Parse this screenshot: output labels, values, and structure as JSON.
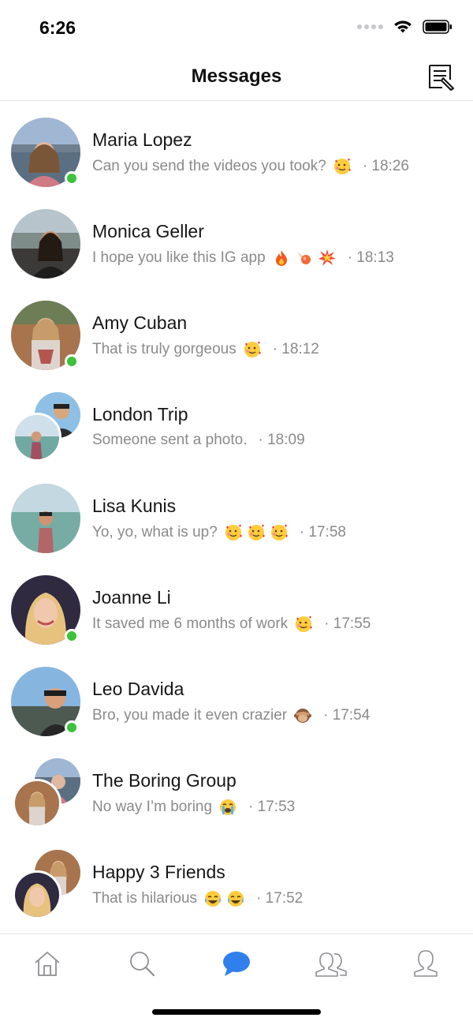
{
  "status_bar": {
    "time": "6:26"
  },
  "nav": {
    "title": "Messages"
  },
  "colors": {
    "online": "#3cc23b",
    "active_tab": "#2f80ed",
    "inactive_tab": "#8e8e93",
    "preview_text": "#8a8a8a"
  },
  "conversations": [
    {
      "name": "Maria Lopez",
      "message": "Can you send the videos you took?",
      "emojis": [
        "smiling-hearts"
      ],
      "time": "· 18:26",
      "online": true,
      "group": false
    },
    {
      "name": "Monica Geller",
      "message": "I hope you like this IG app",
      "emojis": [
        "fire",
        "comet",
        "collision"
      ],
      "time": "· 18:13",
      "online": false,
      "group": false
    },
    {
      "name": "Amy Cuban",
      "message": "That is truly gorgeous",
      "emojis": [
        "smiling-hearts"
      ],
      "time": "· 18:12",
      "online": true,
      "group": false
    },
    {
      "name": "London Trip",
      "message": "Someone sent a photo.",
      "emojis": [],
      "time": "· 18:09",
      "online": false,
      "group": true
    },
    {
      "name": "Lisa Kunis",
      "message": "Yo, yo, what is up?",
      "emojis": [
        "smiling-hearts",
        "smiling-hearts",
        "smiling-hearts"
      ],
      "time": "· 17:58",
      "online": false,
      "group": false
    },
    {
      "name": "Joanne Li",
      "message": "It saved me 6 months of work",
      "emojis": [
        "smiling-hearts"
      ],
      "time": "· 17:55",
      "online": true,
      "group": false
    },
    {
      "name": "Leo Davida",
      "message": "Bro, you made it even crazier",
      "emojis": [
        "see-no-evil-monkey"
      ],
      "time": "· 17:54",
      "online": true,
      "group": false
    },
    {
      "name": "The Boring Group",
      "message": "No way I’m boring",
      "emojis": [
        "crying-face"
      ],
      "time": "· 17:53",
      "online": false,
      "group": true
    },
    {
      "name": "Happy 3 Friends",
      "message": "That is hilarious",
      "emojis": [
        "tears-of-joy",
        "tears-of-joy"
      ],
      "time": "· 17:52",
      "online": false,
      "group": true
    }
  ],
  "tabs": [
    {
      "icon": "home-icon",
      "active": false
    },
    {
      "icon": "search-icon",
      "active": false
    },
    {
      "icon": "chat-bubble-icon",
      "active": true
    },
    {
      "icon": "friends-icon",
      "active": false
    },
    {
      "icon": "profile-icon",
      "active": false
    }
  ]
}
